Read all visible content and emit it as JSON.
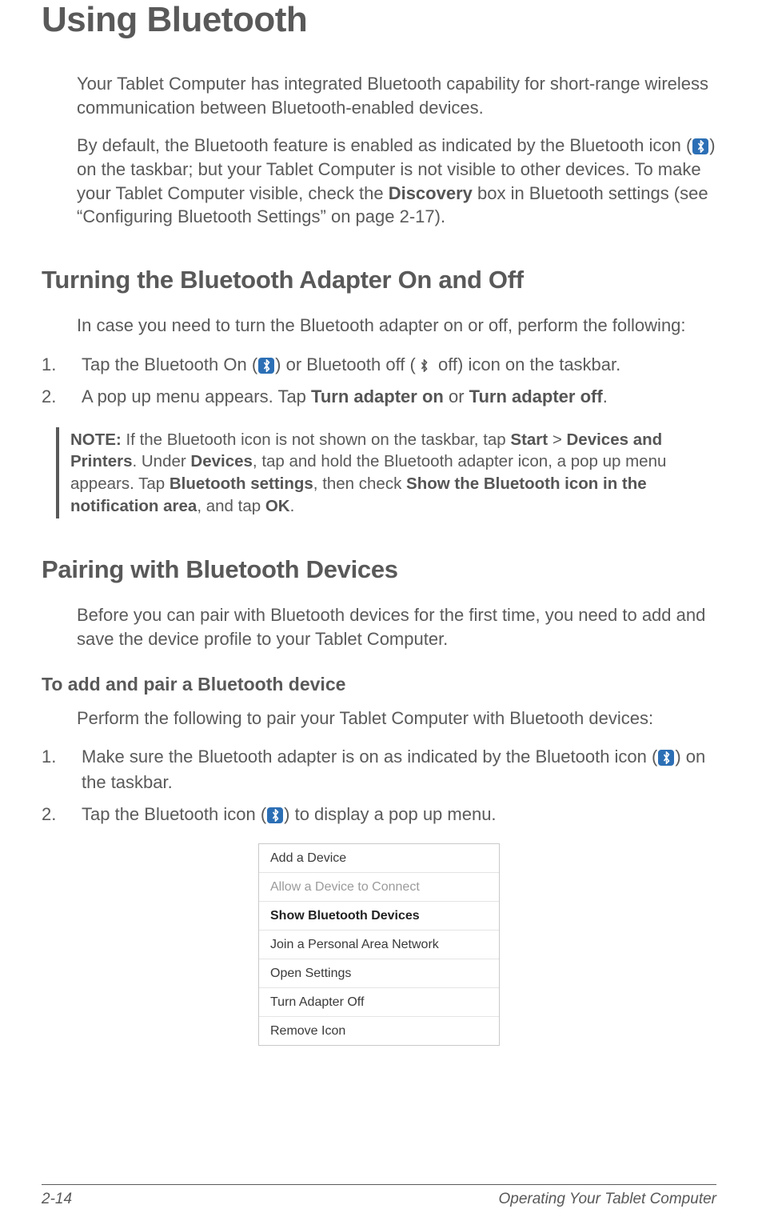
{
  "heading_main": "Using Bluetooth",
  "intro1": "Your Tablet Computer has integrated Bluetooth capability for short-range wireless communication between Bluetooth-enabled devices.",
  "intro2_a": "By default, the Bluetooth feature is enabled as indicated by the Bluetooth icon (",
  "intro2_b": ") on the taskbar; but your Tablet Computer is not visible to other devices. To make your Tablet Computer visible, check the ",
  "intro2_bold": "Discovery",
  "intro2_c": " box in Bluetooth settings (see “Configuring Bluetooth Settings” on page 2-17).",
  "section2_heading": "Turning the Bluetooth Adapter On and Off",
  "section2_intro": "In case you need to turn the Bluetooth adapter on or off, perform the following:",
  "s2_step1_a": "Tap the Bluetooth On (",
  "s2_step1_b": ") or Bluetooth off (",
  "s2_step1_c": " off) icon on the taskbar.",
  "s2_step2_a": "A pop up menu appears. Tap ",
  "s2_step2_bold1": "Turn adapter on",
  "s2_step2_b": " or ",
  "s2_step2_bold2": "Turn adapter off",
  "s2_step2_c": ".",
  "note_label": "NOTE:",
  "note_a": " If the Bluetooth icon is not shown on the taskbar, tap ",
  "note_b1": "Start",
  "note_b": " > ",
  "note_b2": "Devices and Printers",
  "note_c": ". Under ",
  "note_b3": "Devices",
  "note_d": ", tap and hold the Bluetooth adapter icon, a pop up menu appears. Tap ",
  "note_b4": "Blue­tooth settings",
  "note_e": ", then check ",
  "note_b5": "Show the Bluetooth icon in the notification area",
  "note_f": ", and tap ",
  "note_b6": "OK",
  "note_g": ".",
  "section3_heading": "Pairing with Bluetooth Devices",
  "section3_intro": "Before you can pair with Bluetooth devices for the first time, you need to add and save the device profile to your Tablet Computer.",
  "subheading": "To add and pair a Bluetooth device",
  "s3_intro": "Perform the following to pair your Tablet Computer with Bluetooth devices:",
  "s3_step1_a": "Make sure the Bluetooth adapter is on as indicated by the Bluetooth icon (",
  "s3_step1_b": ") on the taskbar.",
  "s3_step2_a": "Tap the Bluetooth icon (",
  "s3_step2_b": ") to display a pop up menu.",
  "menu": {
    "items": [
      {
        "label": "Add a Device",
        "disabled": false,
        "bold": false
      },
      {
        "label": "Allow a Device to Connect",
        "disabled": true,
        "bold": false
      },
      {
        "label": "Show Bluetooth Devices",
        "disabled": false,
        "bold": true
      },
      {
        "label": "Join a Personal Area Network",
        "disabled": false,
        "bold": false
      },
      {
        "label": "Open Settings",
        "disabled": false,
        "bold": false
      },
      {
        "label": "Turn Adapter Off",
        "disabled": false,
        "bold": false
      },
      {
        "label": "Remove Icon",
        "disabled": false,
        "bold": false
      }
    ]
  },
  "footer": {
    "page": "2-14",
    "chapter": "Operating Your Tablet Computer"
  }
}
